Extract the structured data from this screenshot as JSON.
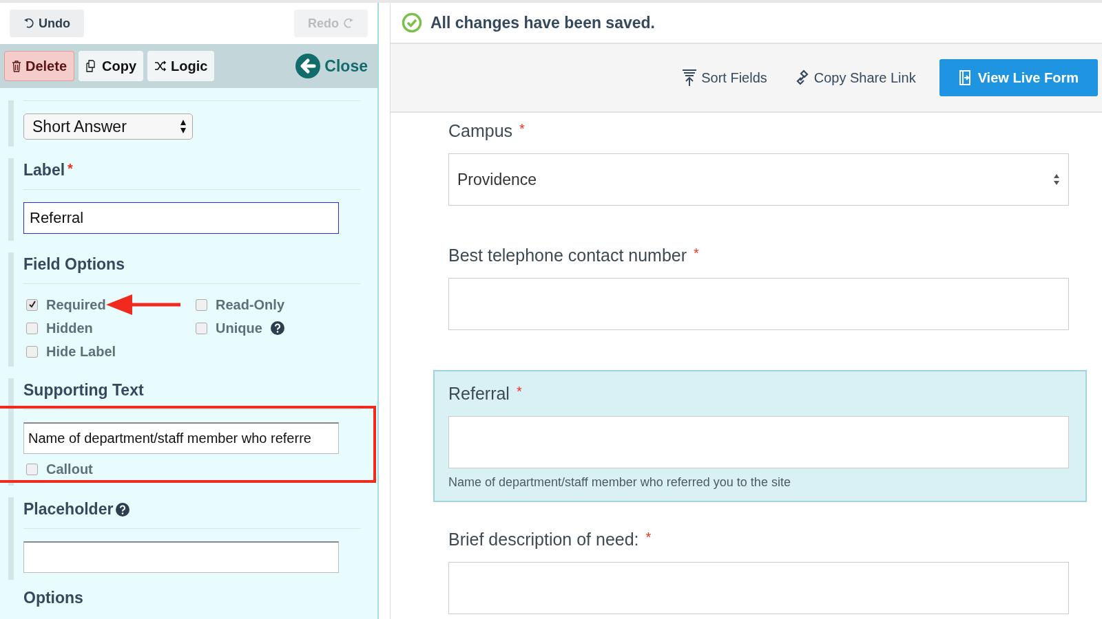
{
  "history": {
    "undo": {
      "label": "Undo",
      "disabled": false
    },
    "redo": {
      "label": "Redo",
      "disabled": true
    }
  },
  "field_toolbar": {
    "delete": "Delete",
    "copy": "Copy",
    "logic": "Logic",
    "close": "Close"
  },
  "editor": {
    "type_select": "Short Answer",
    "label": {
      "heading": "Label",
      "required_mark": "*",
      "value": "Referral"
    },
    "field_options": {
      "heading": "Field Options",
      "options": [
        {
          "label": "Required",
          "checked": true
        },
        {
          "label": "Read-Only",
          "checked": false
        },
        {
          "label": "Hidden",
          "checked": false
        },
        {
          "label": "Unique",
          "checked": false,
          "help": true
        },
        {
          "label": "Hide Label",
          "checked": false
        }
      ]
    },
    "supporting_text": {
      "heading": "Supporting Text",
      "value": "Name of department/staff member who referre",
      "callout": {
        "label": "Callout",
        "checked": false
      }
    },
    "placeholder": {
      "heading": "Placeholder",
      "help": true
    },
    "options_heading": "Options"
  },
  "status": "All changes have been saved.",
  "form_toolbar": {
    "sort": "Sort Fields",
    "share": "Copy Share Link",
    "view": "View Live Form"
  },
  "form_fields": [
    {
      "kind": "select",
      "label": "Campus",
      "required_mark": "*",
      "value": "Providence",
      "selected": false
    },
    {
      "kind": "text",
      "label": "Best telephone contact number",
      "required_mark": "*",
      "selected": false
    },
    {
      "kind": "text",
      "label": "Referral",
      "required_mark": "*",
      "selected": true,
      "help_text": "Name of department/staff member who referred you to the site"
    },
    {
      "kind": "text",
      "label": "Brief description of need:",
      "required_mark": "*",
      "selected": false
    }
  ]
}
